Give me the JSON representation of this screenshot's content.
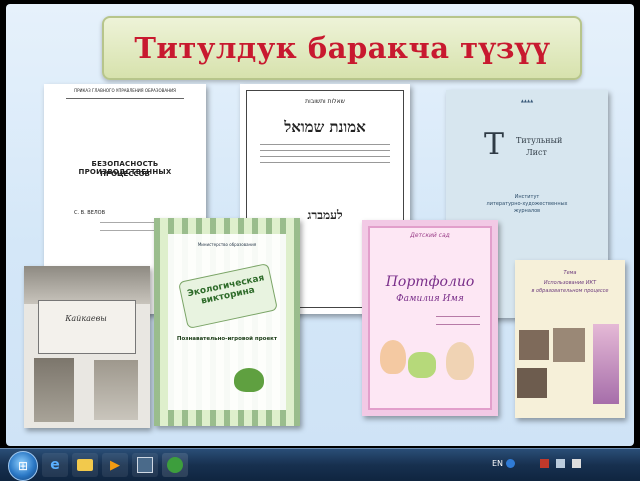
{
  "slide": {
    "title": "Титулдук баракча түзүү"
  },
  "cards": {
    "doc1": {
      "header": "ПРИКАЗ ГЛАВНОГО УПРАВЛЕНИЯ ОБРАЗОВАНИЯ",
      "title_line1": "БЕЗОПАСНОСТЬ ПРОИЗВОДСТВЕННЫХ",
      "title_line2": "ПРОЦЕССОВ",
      "author": "С. В. ВЕЛОВ"
    },
    "doc2": {
      "header": "שאלות ותשובות",
      "title": "אמונת שמואל",
      "subtitle": "לעמברג"
    },
    "doc3": {
      "logo_line1": "Титульный",
      "logo_line2": "Лист",
      "label1": "Институт",
      "label2": "литературно-художественных",
      "label3": "журналов"
    },
    "doc4": {
      "caption": "Кайкаевы"
    },
    "doc5": {
      "header": "Министерство образования",
      "banner1": "Экологическая",
      "banner2": "викторина",
      "project": "Познавательно-игровой проект"
    },
    "doc6": {
      "top": "Детский сад",
      "title": "Портфолио",
      "name": "Фамилия Имя"
    },
    "doc7": {
      "line1": "Тема",
      "line2": "Использование ИКТ",
      "line3": "в образовательном процессе"
    }
  },
  "taskbar": {
    "language": "EN",
    "icons": [
      "windows-start-icon",
      "internet-explorer-icon",
      "folder-icon",
      "media-player-icon",
      "app-icon",
      "powerpoint-icon"
    ],
    "tray_icons": [
      "help-icon",
      "flag-icon",
      "network-icon",
      "volume-icon"
    ]
  },
  "colors": {
    "title_text": "#c8192f",
    "title_bg": "#dbe5b4",
    "slide_bg": "#dcebf9",
    "taskbar": "#1b365a"
  }
}
